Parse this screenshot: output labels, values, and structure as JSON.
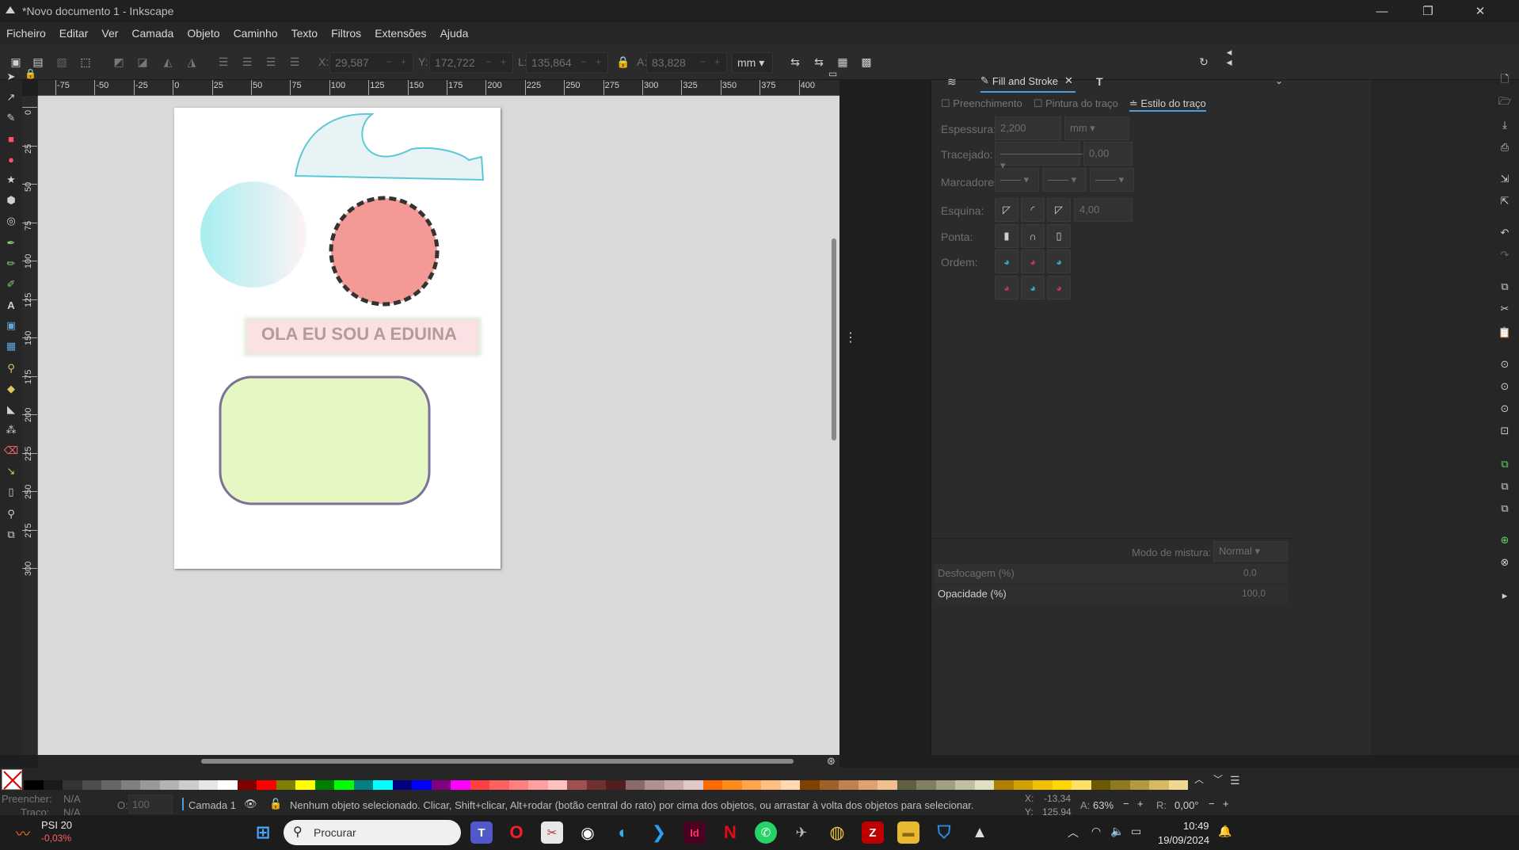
{
  "window": {
    "title": "*Novo documento 1 - Inkscape",
    "minimize_glyph": "—",
    "maximize_glyph": "❐",
    "close_glyph": "✕"
  },
  "menu": [
    "Ficheiro",
    "Editar",
    "Ver",
    "Camada",
    "Objeto",
    "Caminho",
    "Texto",
    "Filtros",
    "Extensões",
    "Ajuda"
  ],
  "toolbar": {
    "x_label": "X:",
    "x_value": "29,587",
    "y_label": "Y:",
    "y_value": "172,722",
    "w_label": "L:",
    "w_value": "135,864",
    "h_label": "A:",
    "h_value": "83,828",
    "unit": "mm"
  },
  "ruler": {
    "h_labels": [
      "-75",
      "-50",
      "-25",
      "0",
      "25",
      "50",
      "75",
      "100",
      "125",
      "150",
      "175",
      "200",
      "225",
      "250",
      "275",
      "300",
      "325",
      "350",
      "375",
      "400"
    ],
    "v_labels": [
      "0",
      "25",
      "50",
      "75",
      "100",
      "125",
      "150",
      "175",
      "200",
      "225",
      "250",
      "275",
      "300"
    ]
  },
  "canvas": {
    "text_object": "OLA EU SOU A EDUINA",
    "colors": {
      "wave_fill": "#e8f3f5",
      "wave_stroke": "#5bc8d6",
      "gradient_start": "#a8eef0",
      "gradient_end": "#fdf3f5",
      "red_circle": "#f49a96",
      "red_circle_stroke": "#333333",
      "text_box": "#fbe1e4",
      "text_color": "#b59b95",
      "rounded_rect": "#e5f7c3",
      "rounded_rect_stroke": "#7a7299"
    }
  },
  "panel": {
    "tab_title": "Fill and Stroke",
    "subtabs": [
      "Preenchimento",
      "Pintura do traço",
      "Estilo do traço"
    ],
    "labels": {
      "width": "Espessura:",
      "dashes": "Tracejado:",
      "markers": "Marcadores:",
      "join": "Esquina:",
      "cap": "Ponta:",
      "order": "Ordem:"
    },
    "width_value": "2,200",
    "width_unit": "mm",
    "dash_offset": "0,00",
    "miter_value": "4,00",
    "blend_label": "Modo de mistura:",
    "blend_value": "Normal",
    "blur_label": "Desfocagem (%)",
    "blur_value": "0,0",
    "opacity_label": "Opacidade (%)",
    "opacity_value": "100,0"
  },
  "palette": {
    "colors": [
      "#000000",
      "#1a1a1a",
      "#333333",
      "#4d4d4d",
      "#666666",
      "#808080",
      "#999999",
      "#b3b3b3",
      "#cccccc",
      "#e6e6e6",
      "#ffffff",
      "#800000",
      "#ff0000",
      "#808000",
      "#ffff00",
      "#008000",
      "#00ff00",
      "#008080",
      "#00ffff",
      "#000080",
      "#0000ff",
      "#800080",
      "#ff00ff",
      "#ff4040",
      "#ff6060",
      "#ff8080",
      "#ffa0a0",
      "#ffc0c0",
      "#a05050",
      "#703030",
      "#502020",
      "#8a6a6a",
      "#b09090",
      "#c8a8a8",
      "#e0c8c8",
      "#ff6a00",
      "#ff8c1a",
      "#ffa64d",
      "#ffbf80",
      "#ffd9b3",
      "#804000",
      "#a0602a",
      "#c08050",
      "#e0a070",
      "#f0c090",
      "#606040",
      "#808060",
      "#a0a080",
      "#c0c0a0",
      "#e0e0c0",
      "#b08000",
      "#d0a000",
      "#f0c000",
      "#ffd700",
      "#ffe066",
      "#6b5a00",
      "#8f7a20",
      "#b39a40",
      "#d7ba60",
      "#efd890"
    ]
  },
  "status": {
    "fill_label": "Preencher:",
    "fill_value": "N/A",
    "stroke_label": "Traço:",
    "stroke_value": "N/A",
    "opacity_label": "O:",
    "opacity_value": "100",
    "layer": "Camada 1",
    "message": "Nenhum objeto selecionado. Clicar, Shift+clicar, Alt+rodar (botão central do rato) por cima dos objetos, ou arrastar à volta dos objetos para selecionar.",
    "cursor_x_label": "X:",
    "cursor_x": "-13,34",
    "cursor_y_label": "Y:",
    "cursor_y": "125,94",
    "zoom_label": "A:",
    "zoom": "63%",
    "rotation_label": "R:",
    "rotation": "0,00°"
  },
  "taskbar": {
    "stock_name": "PSI 20",
    "stock_change": "-0,03%",
    "search_placeholder": "Procurar",
    "time": "10:49",
    "date": "19/09/2024"
  }
}
